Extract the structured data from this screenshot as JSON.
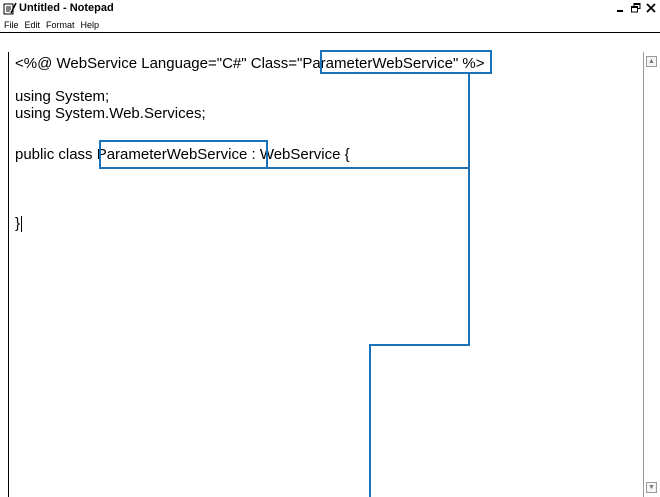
{
  "window": {
    "title": "Untitled - Notepad",
    "controls": {
      "minimize": "_",
      "restore": "Δ",
      "close": "×"
    }
  },
  "menu": [
    "File",
    "Edit",
    "Format",
    "Help"
  ],
  "editor": {
    "lines": {
      "line1": "<%@ WebService Language=\"C#\" Class=\"ParameterWebService\" %>",
      "line2": "using System;",
      "line3": "using System.Web.Services;",
      "line4": "public class ParameterWebService : WebService {",
      "line5": "}"
    }
  },
  "scrollbar": {
    "up_arrow": "▲",
    "down_arrow": "▼"
  },
  "colors": {
    "highlight": "#1a73b8"
  },
  "icons": {
    "app": "notepad-icon"
  }
}
